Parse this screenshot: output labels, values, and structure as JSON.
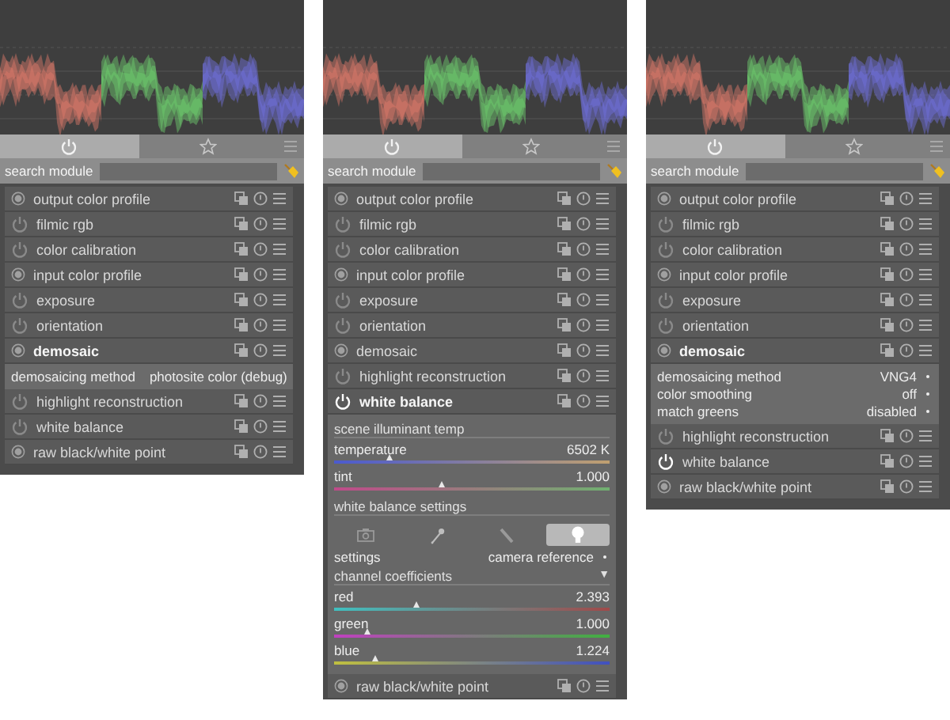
{
  "panels": [
    {
      "tabs": [
        {
          "kind": "power",
          "selected": true
        },
        {
          "kind": "star",
          "selected": false
        }
      ],
      "search": {
        "label": "search module"
      },
      "modules": [
        {
          "name": "output color profile",
          "kind": "fixed",
          "on": true,
          "focused": false
        },
        {
          "name": "filmic rgb",
          "kind": "power",
          "on": false,
          "focused": false
        },
        {
          "name": "color calibration",
          "kind": "power",
          "on": false,
          "focused": false
        },
        {
          "name": "input color profile",
          "kind": "fixed",
          "on": true,
          "focused": false
        },
        {
          "name": "exposure",
          "kind": "power",
          "on": false,
          "focused": false
        },
        {
          "name": "orientation",
          "kind": "power",
          "on": false,
          "focused": false
        },
        {
          "name": "demosaic",
          "kind": "fixed",
          "on": true,
          "focused": true,
          "params": [
            {
              "label": "demosaicing method",
              "value": "photosite color (debug)"
            }
          ]
        },
        {
          "name": "highlight reconstruction",
          "kind": "power",
          "on": false,
          "focused": false
        },
        {
          "name": "white balance",
          "kind": "power",
          "on": false,
          "focused": false
        },
        {
          "name": "raw black/white point",
          "kind": "fixed",
          "on": true,
          "focused": false
        }
      ]
    },
    {
      "tabs": [
        {
          "kind": "power",
          "selected": true
        },
        {
          "kind": "star",
          "selected": false
        }
      ],
      "search": {
        "label": "search module"
      },
      "modules": [
        {
          "name": "output color profile",
          "kind": "fixed",
          "on": true,
          "focused": false
        },
        {
          "name": "filmic rgb",
          "kind": "power",
          "on": false,
          "focused": false
        },
        {
          "name": "color calibration",
          "kind": "power",
          "on": false,
          "focused": false
        },
        {
          "name": "input color profile",
          "kind": "fixed",
          "on": true,
          "focused": false
        },
        {
          "name": "exposure",
          "kind": "power",
          "on": false,
          "focused": false
        },
        {
          "name": "orientation",
          "kind": "power",
          "on": false,
          "focused": false
        },
        {
          "name": "demosaic",
          "kind": "fixed",
          "on": true,
          "focused": false
        },
        {
          "name": "highlight reconstruction",
          "kind": "power",
          "on": false,
          "focused": false
        },
        {
          "name": "white balance",
          "kind": "power",
          "on": true,
          "focused": true,
          "sections": [
            {
              "title": "scene illuminant temp",
              "sliders": [
                {
                  "label": "temperature",
                  "value": "6502 K",
                  "level": 0.2,
                  "kind": "temp"
                },
                {
                  "label": "tint",
                  "value": "1.000",
                  "level": 0.39,
                  "kind": "tint"
                }
              ]
            },
            {
              "title": "white balance settings",
              "buttons": [
                {
                  "kind": "camera",
                  "selected": false
                },
                {
                  "kind": "picker",
                  "selected": false
                },
                {
                  "kind": "pencil",
                  "selected": false
                },
                {
                  "kind": "bulb",
                  "selected": true
                }
              ],
              "label": "settings",
              "value": "camera reference"
            },
            {
              "title": "channel coefficients",
              "arrow": "▼",
              "sliders": [
                {
                  "label": "red",
                  "value": "2.393",
                  "level": 0.3,
                  "kind": "red"
                },
                {
                  "label": "green",
                  "value": "1.000",
                  "level": 0.12,
                  "kind": "green"
                },
                {
                  "label": "blue",
                  "value": "1.224",
                  "level": 0.15,
                  "kind": "blue"
                }
              ]
            }
          ]
        },
        {
          "name": "raw black/white point",
          "kind": "fixed",
          "on": true,
          "focused": false
        }
      ]
    },
    {
      "tabs": [
        {
          "kind": "power",
          "selected": true
        },
        {
          "kind": "star",
          "selected": false
        }
      ],
      "search": {
        "label": "search module"
      },
      "modules": [
        {
          "name": "output color profile",
          "kind": "fixed",
          "on": true,
          "focused": false
        },
        {
          "name": "filmic rgb",
          "kind": "power",
          "on": false,
          "focused": false
        },
        {
          "name": "color calibration",
          "kind": "power",
          "on": false,
          "focused": false
        },
        {
          "name": "input color profile",
          "kind": "fixed",
          "on": true,
          "focused": false
        },
        {
          "name": "exposure",
          "kind": "power",
          "on": false,
          "focused": false
        },
        {
          "name": "orientation",
          "kind": "power",
          "on": false,
          "focused": false
        },
        {
          "name": "demosaic",
          "kind": "fixed",
          "on": true,
          "focused": true,
          "params": [
            {
              "label": "demosaicing method",
              "value": "VNG4"
            },
            {
              "label": "color smoothing",
              "value": "off"
            },
            {
              "label": "match greens",
              "value": "disabled"
            }
          ]
        },
        {
          "name": "highlight reconstruction",
          "kind": "power",
          "on": false,
          "focused": false
        },
        {
          "name": "white balance",
          "kind": "power",
          "on": true,
          "focused": false
        },
        {
          "name": "raw black/white point",
          "kind": "fixed",
          "on": true,
          "focused": false
        }
      ]
    }
  ]
}
